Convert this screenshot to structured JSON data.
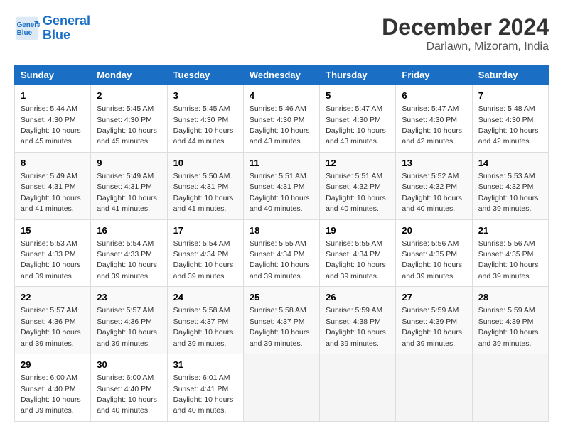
{
  "header": {
    "logo_line1": "General",
    "logo_line2": "Blue",
    "main_title": "December 2024",
    "subtitle": "Darlawn, Mizoram, India"
  },
  "weekdays": [
    "Sunday",
    "Monday",
    "Tuesday",
    "Wednesday",
    "Thursday",
    "Friday",
    "Saturday"
  ],
  "weeks": [
    [
      {
        "day": "1",
        "sunrise": "5:44 AM",
        "sunset": "4:30 PM",
        "daylight": "10 hours and 45 minutes."
      },
      {
        "day": "2",
        "sunrise": "5:45 AM",
        "sunset": "4:30 PM",
        "daylight": "10 hours and 45 minutes."
      },
      {
        "day": "3",
        "sunrise": "5:45 AM",
        "sunset": "4:30 PM",
        "daylight": "10 hours and 44 minutes."
      },
      {
        "day": "4",
        "sunrise": "5:46 AM",
        "sunset": "4:30 PM",
        "daylight": "10 hours and 43 minutes."
      },
      {
        "day": "5",
        "sunrise": "5:47 AM",
        "sunset": "4:30 PM",
        "daylight": "10 hours and 43 minutes."
      },
      {
        "day": "6",
        "sunrise": "5:47 AM",
        "sunset": "4:30 PM",
        "daylight": "10 hours and 42 minutes."
      },
      {
        "day": "7",
        "sunrise": "5:48 AM",
        "sunset": "4:30 PM",
        "daylight": "10 hours and 42 minutes."
      }
    ],
    [
      {
        "day": "8",
        "sunrise": "5:49 AM",
        "sunset": "4:31 PM",
        "daylight": "10 hours and 41 minutes."
      },
      {
        "day": "9",
        "sunrise": "5:49 AM",
        "sunset": "4:31 PM",
        "daylight": "10 hours and 41 minutes."
      },
      {
        "day": "10",
        "sunrise": "5:50 AM",
        "sunset": "4:31 PM",
        "daylight": "10 hours and 41 minutes."
      },
      {
        "day": "11",
        "sunrise": "5:51 AM",
        "sunset": "4:31 PM",
        "daylight": "10 hours and 40 minutes."
      },
      {
        "day": "12",
        "sunrise": "5:51 AM",
        "sunset": "4:32 PM",
        "daylight": "10 hours and 40 minutes."
      },
      {
        "day": "13",
        "sunrise": "5:52 AM",
        "sunset": "4:32 PM",
        "daylight": "10 hours and 40 minutes."
      },
      {
        "day": "14",
        "sunrise": "5:53 AM",
        "sunset": "4:32 PM",
        "daylight": "10 hours and 39 minutes."
      }
    ],
    [
      {
        "day": "15",
        "sunrise": "5:53 AM",
        "sunset": "4:33 PM",
        "daylight": "10 hours and 39 minutes."
      },
      {
        "day": "16",
        "sunrise": "5:54 AM",
        "sunset": "4:33 PM",
        "daylight": "10 hours and 39 minutes."
      },
      {
        "day": "17",
        "sunrise": "5:54 AM",
        "sunset": "4:34 PM",
        "daylight": "10 hours and 39 minutes."
      },
      {
        "day": "18",
        "sunrise": "5:55 AM",
        "sunset": "4:34 PM",
        "daylight": "10 hours and 39 minutes."
      },
      {
        "day": "19",
        "sunrise": "5:55 AM",
        "sunset": "4:34 PM",
        "daylight": "10 hours and 39 minutes."
      },
      {
        "day": "20",
        "sunrise": "5:56 AM",
        "sunset": "4:35 PM",
        "daylight": "10 hours and 39 minutes."
      },
      {
        "day": "21",
        "sunrise": "5:56 AM",
        "sunset": "4:35 PM",
        "daylight": "10 hours and 39 minutes."
      }
    ],
    [
      {
        "day": "22",
        "sunrise": "5:57 AM",
        "sunset": "4:36 PM",
        "daylight": "10 hours and 39 minutes."
      },
      {
        "day": "23",
        "sunrise": "5:57 AM",
        "sunset": "4:36 PM",
        "daylight": "10 hours and 39 minutes."
      },
      {
        "day": "24",
        "sunrise": "5:58 AM",
        "sunset": "4:37 PM",
        "daylight": "10 hours and 39 minutes."
      },
      {
        "day": "25",
        "sunrise": "5:58 AM",
        "sunset": "4:37 PM",
        "daylight": "10 hours and 39 minutes."
      },
      {
        "day": "26",
        "sunrise": "5:59 AM",
        "sunset": "4:38 PM",
        "daylight": "10 hours and 39 minutes."
      },
      {
        "day": "27",
        "sunrise": "5:59 AM",
        "sunset": "4:39 PM",
        "daylight": "10 hours and 39 minutes."
      },
      {
        "day": "28",
        "sunrise": "5:59 AM",
        "sunset": "4:39 PM",
        "daylight": "10 hours and 39 minutes."
      }
    ],
    [
      {
        "day": "29",
        "sunrise": "6:00 AM",
        "sunset": "4:40 PM",
        "daylight": "10 hours and 39 minutes."
      },
      {
        "day": "30",
        "sunrise": "6:00 AM",
        "sunset": "4:40 PM",
        "daylight": "10 hours and 40 minutes."
      },
      {
        "day": "31",
        "sunrise": "6:01 AM",
        "sunset": "4:41 PM",
        "daylight": "10 hours and 40 minutes."
      },
      null,
      null,
      null,
      null
    ]
  ]
}
